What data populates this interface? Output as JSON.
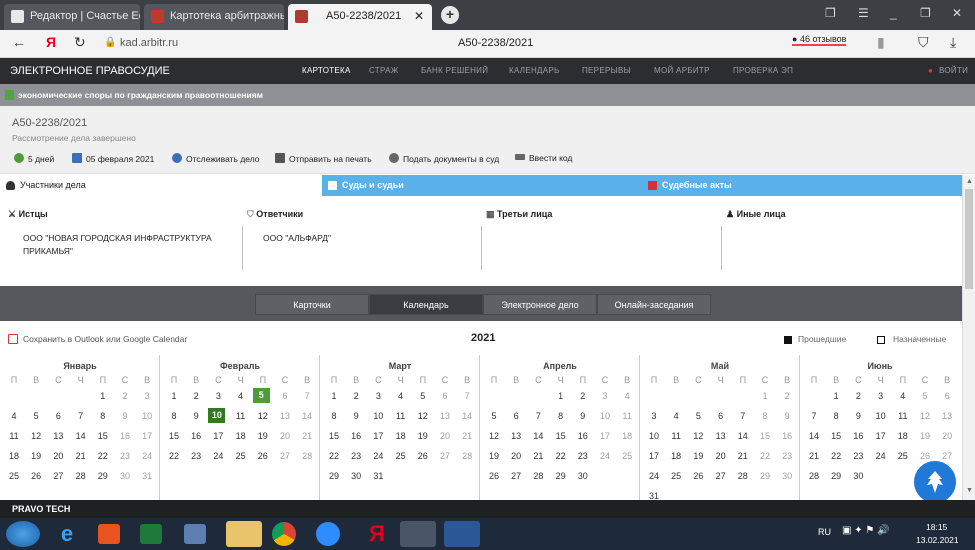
{
  "browser": {
    "tabs": [
      {
        "label": "Редактор | Счастье Есть!",
        "color": "#e8e8e8"
      },
      {
        "label": "Картотека арбитражных д",
        "color": "#c0392b"
      },
      {
        "label": "А50-2238/2021",
        "color": "#b03a2e"
      }
    ],
    "url": "kad.arbitr.ru",
    "page_title": "А50-2238/2021",
    "reviews": "46 отзывов"
  },
  "site": {
    "brand": "ЭЛЕКТРОННОЕ ПРАВОСУДИЕ",
    "nav": [
      "КАРТОТЕКА",
      "СТРАЖ",
      "БАНК РЕШЕНИЙ",
      "КАЛЕНДАРЬ",
      "ПЕРЕРЫВЫ",
      "МОЙ АРБИТР",
      "ПРОВЕРКА ЭП"
    ],
    "login": "ВОЙТИ"
  },
  "category": "экономические споры по гражданским правоотношениям",
  "case": {
    "number": "А50-2238/2021",
    "status": "Рассмотрение дела завершено",
    "actions": {
      "days": "5 дней",
      "date": "05 февраля 2021",
      "track": "Отслеживать дело",
      "print": "Отправить на печать",
      "submit": "Подать документы в суд",
      "code": "Ввести код"
    }
  },
  "section_tabs": [
    "Участники дела",
    "Суды и судьи",
    "Судебные акты"
  ],
  "parties": {
    "plaintiffs_label": "Истцы",
    "defendants_label": "Ответчики",
    "third_label": "Третьи лица",
    "other_label": "Иные лица",
    "plaintiff": "ООО \"НОВАЯ ГОРОДСКАЯ ИНФРАСТРУКТУРА ПРИКАМЬЯ\"",
    "defendant": "ООО \"АЛЬФАРД\""
  },
  "switch_tabs": [
    "Карточки",
    "Календарь",
    "Электронное дело",
    "Онлайн-заседания"
  ],
  "calendar": {
    "export": "Сохранить в Outlook или Google Calendar",
    "year": "2021",
    "legend_past": "Прошедшие",
    "legend_scheduled": "Назначенные",
    "weekdays": [
      "П",
      "В",
      "С",
      "Ч",
      "П",
      "С",
      "В"
    ],
    "months": [
      {
        "name": "Январь",
        "rows": [
          [
            "",
            "",
            "",
            "",
            1,
            2,
            3
          ],
          [
            4,
            5,
            6,
            7,
            8,
            9,
            10
          ],
          [
            11,
            12,
            13,
            14,
            15,
            16,
            17
          ],
          [
            18,
            19,
            20,
            21,
            22,
            23,
            24
          ],
          [
            25,
            26,
            27,
            28,
            29,
            30,
            31
          ]
        ]
      },
      {
        "name": "Февраль",
        "rows": [
          [
            1,
            2,
            3,
            4,
            5,
            6,
            7
          ],
          [
            8,
            9,
            10,
            11,
            12,
            13,
            14
          ],
          [
            15,
            16,
            17,
            18,
            19,
            20,
            21
          ],
          [
            22,
            23,
            24,
            25,
            26,
            27,
            28
          ]
        ]
      },
      {
        "name": "Март",
        "rows": [
          [
            1,
            2,
            3,
            4,
            5,
            6,
            7
          ],
          [
            8,
            9,
            10,
            11,
            12,
            13,
            14
          ],
          [
            15,
            16,
            17,
            18,
            19,
            20,
            21
          ],
          [
            22,
            23,
            24,
            25,
            26,
            27,
            28
          ],
          [
            29,
            30,
            31,
            "",
            "",
            "",
            ""
          ]
        ]
      },
      {
        "name": "Апрель",
        "rows": [
          [
            "",
            "",
            "",
            1,
            2,
            3,
            4
          ],
          [
            5,
            6,
            7,
            8,
            9,
            10,
            11
          ],
          [
            12,
            13,
            14,
            15,
            16,
            17,
            18
          ],
          [
            19,
            20,
            21,
            22,
            23,
            24,
            25
          ],
          [
            26,
            27,
            28,
            29,
            30,
            "",
            ""
          ]
        ]
      },
      {
        "name": "Май",
        "rows": [
          [
            "",
            "",
            "",
            "",
            "",
            1,
            2
          ],
          [
            3,
            4,
            5,
            6,
            7,
            8,
            9
          ],
          [
            10,
            11,
            12,
            13,
            14,
            15,
            16
          ],
          [
            17,
            18,
            19,
            20,
            21,
            22,
            23
          ],
          [
            24,
            25,
            26,
            27,
            28,
            29,
            30
          ],
          [
            31,
            "",
            "",
            "",
            "",
            "",
            ""
          ]
        ]
      },
      {
        "name": "Июнь",
        "rows": [
          [
            "",
            1,
            2,
            3,
            4,
            5,
            6
          ],
          [
            7,
            8,
            9,
            10,
            11,
            12,
            13
          ],
          [
            14,
            15,
            16,
            17,
            18,
            19,
            20
          ],
          [
            21,
            22,
            23,
            24,
            25,
            26,
            27
          ],
          [
            28,
            29,
            30,
            "",
            "",
            "",
            ""
          ]
        ]
      }
    ],
    "highlighted": [
      "Февраль-10",
      "Февраль-5"
    ]
  },
  "footer": {
    "brand": "PRAVO TECH"
  },
  "taskbar": {
    "lang": "RU",
    "time": "18:15",
    "date": "13.02.2021"
  }
}
